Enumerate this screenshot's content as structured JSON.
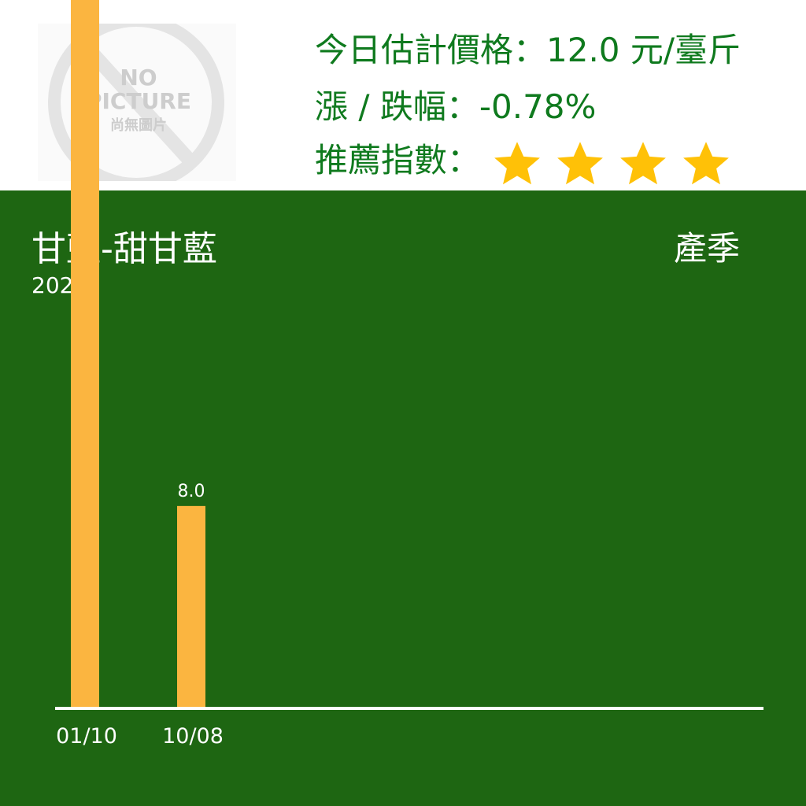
{
  "header": {
    "price_label": "今日估計價格：",
    "price_value": "12.0",
    "price_unit": "元/臺斤",
    "change_label": "漲 / 跌幅：",
    "change_value": "-0.78%",
    "rating_label": "推薦指數：",
    "rating_stars": 4,
    "star_icon": "star-icon",
    "accent_color": "#0f7a1e",
    "star_color": "#ffc107"
  },
  "placeholder_image": {
    "icon": "no-picture-icon",
    "line1": "NO",
    "line2": "PICTURE",
    "line3": "尚無圖片"
  },
  "panel": {
    "product_name": "甘藍-甜甘藍",
    "season_label": "產季",
    "date_text": "202",
    "background_color": "#1e6612"
  },
  "chart_data": {
    "type": "bar",
    "categories": [
      "01/10",
      "10/08"
    ],
    "values": [
      28.0,
      8.0
    ],
    "data_labels": [
      "",
      "8.0"
    ],
    "ylim": [
      0,
      28.0
    ],
    "bar_color": "#fbb540",
    "axis_color": "#ffffff",
    "grid": false,
    "title": "",
    "xlabel": "",
    "ylabel": ""
  }
}
